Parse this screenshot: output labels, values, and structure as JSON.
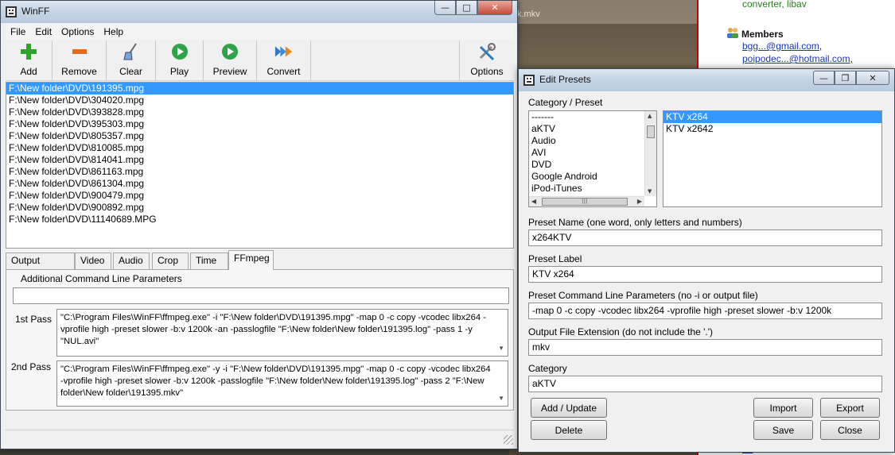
{
  "background": {
    "tab_text": "k.mkv",
    "links": [
      "converter",
      "libav"
    ],
    "members_title": "Members",
    "members": [
      "bgg...@gmail.com",
      "poipodec...@hotmail.com"
    ],
    "bottom_fragment": "EE"
  },
  "winff": {
    "title": "WinFF",
    "menu": [
      "File",
      "Edit",
      "Options",
      "Help"
    ],
    "toolbar": {
      "add": "Add",
      "remove": "Remove",
      "clear": "Clear",
      "play": "Play",
      "preview": "Preview",
      "convert": "Convert",
      "options": "Options"
    },
    "files": [
      "F:\\New folder\\DVD\\191395.mpg",
      "F:\\New folder\\DVD\\304020.mpg",
      "F:\\New folder\\DVD\\393828.mpg",
      "F:\\New folder\\DVD\\395303.mpg",
      "F:\\New folder\\DVD\\805357.mpg",
      "F:\\New folder\\DVD\\810085.mpg",
      "F:\\New folder\\DVD\\814041.mpg",
      "F:\\New folder\\DVD\\861163.mpg",
      "F:\\New folder\\DVD\\861304.mpg",
      "F:\\New folder\\DVD\\900479.mpg",
      "F:\\New folder\\DVD\\900892.mpg",
      "F:\\New folder\\DVD\\11140689.MPG"
    ],
    "selected_file_index": 0,
    "tabs": [
      "Output Details",
      "Video",
      "Audio",
      "Crop",
      "Time",
      "FFmpeg"
    ],
    "active_tab": "FFmpeg",
    "ffmpeg": {
      "additional_label": "Additional Command Line Parameters",
      "additional_value": "",
      "pass1_label": "1st Pass",
      "pass1_value": "\"C:\\Program Files\\WinFF\\ffmpeg.exe\" -i \"F:\\New folder\\DVD\\191395.mpg\" -map 0 -c copy -vcodec libx264 -vprofile high -preset slower -b:v 1200k -an -passlogfile \"F:\\New folder\\New folder\\191395.log\" -pass 1  -y \"NUL.avi\"",
      "pass2_label": "2nd Pass",
      "pass2_value": "\"C:\\Program Files\\WinFF\\ffmpeg.exe\" -y -i \"F:\\New folder\\DVD\\191395.mpg\" -map 0 -c copy -vcodec libx264 -vprofile high -preset slower -b:v 1200k -passlogfile \"F:\\New folder\\New folder\\191395.log\" -pass 2  \"F:\\New folder\\New folder\\191395.mkv\""
    }
  },
  "presets": {
    "title": "Edit Presets",
    "category_preset_label": "Category / Preset",
    "categories": [
      "-------",
      "aKTV",
      "Audio",
      "AVI",
      "DVD",
      "Google Android",
      "iPod-iTunes"
    ],
    "presets_list": [
      "KTV x264",
      "KTV x2642"
    ],
    "selected_preset_index": 0,
    "preset_name_label": "Preset Name (one word, only letters and numbers)",
    "preset_name_value": "x264KTV",
    "preset_label_label": "Preset Label",
    "preset_label_value": "KTV x264",
    "cmdline_label": "Preset Command Line Parameters (no -i or output file)",
    "cmdline_value": "-map 0 -c copy -vcodec libx264 -vprofile high -preset slower -b:v 1200k",
    "ext_label": "Output File Extension (do not include the '.')",
    "ext_value": "mkv",
    "category_label": "Category",
    "category_value": "aKTV",
    "buttons": {
      "add_update": "Add / Update",
      "delete": "Delete",
      "import": "Import",
      "export": "Export",
      "save": "Save",
      "close": "Close"
    }
  },
  "colors": {
    "selection": "#3399ff",
    "titlebar": "#c6d6e6",
    "close_button": "#c7483a",
    "link_green": "#2a7a20",
    "link_blue": "#1a3aa8"
  }
}
